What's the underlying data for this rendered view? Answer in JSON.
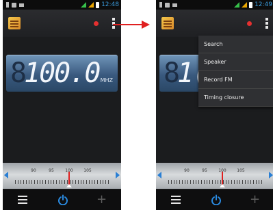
{
  "left_screen": {
    "status_time": "12:48",
    "frequency": "100.0",
    "frequency_ghost": "8",
    "unit": "MHZ",
    "scale_labels": [
      "90",
      "95",
      "100",
      "105"
    ]
  },
  "right_screen": {
    "status_time": "12:49",
    "frequency_partial": "1(",
    "scale_labels": [
      "90",
      "95",
      "100",
      "105"
    ],
    "menu_items": [
      "Search",
      "Speaker",
      "Record FM",
      "Timing closure"
    ]
  },
  "colors": {
    "accent": "#3a9bdc",
    "record": "#e53030",
    "arrow": "#e02020",
    "menu_bg": "#2f3033"
  },
  "icons": [
    "settings-icon",
    "hamburger-menu-icon",
    "power-icon",
    "add-icon",
    "record-icon",
    "overflow-menu-icon"
  ]
}
